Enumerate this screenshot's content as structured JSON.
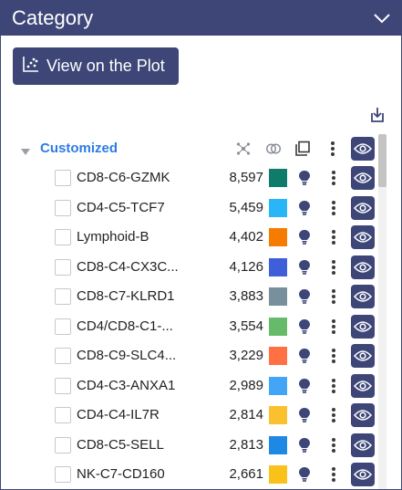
{
  "header": {
    "title": "Category"
  },
  "view_button": {
    "label": "View on the Plot"
  },
  "group": {
    "label": "Customized"
  },
  "colors": {
    "primary": "#3d4677",
    "link": "#2d7be5"
  },
  "items": [
    {
      "name": "CD8-C6-GZMK",
      "count": "8,597",
      "color": "#0e7b6b"
    },
    {
      "name": "CD4-C5-TCF7",
      "count": "5,459",
      "color": "#29b6f6"
    },
    {
      "name": "Lymphoid-B",
      "count": "4,402",
      "color": "#f57c00"
    },
    {
      "name": "CD8-C4-CX3C...",
      "count": "4,126",
      "color": "#3f5fd9"
    },
    {
      "name": "CD8-C7-KLRD1",
      "count": "3,883",
      "color": "#78909c"
    },
    {
      "name": "CD4/CD8-C1-...",
      "count": "3,554",
      "color": "#66bb6a"
    },
    {
      "name": "CD8-C9-SLC4...",
      "count": "3,229",
      "color": "#ff7043"
    },
    {
      "name": "CD4-C3-ANXA1",
      "count": "2,989",
      "color": "#42a5f5"
    },
    {
      "name": "CD4-C4-IL7R",
      "count": "2,814",
      "color": "#fbc02d"
    },
    {
      "name": "CD8-C5-SELL",
      "count": "2,813",
      "color": "#1e88e5"
    },
    {
      "name": "NK-C7-CD160",
      "count": "2,661",
      "color": "#f9c21b"
    }
  ]
}
